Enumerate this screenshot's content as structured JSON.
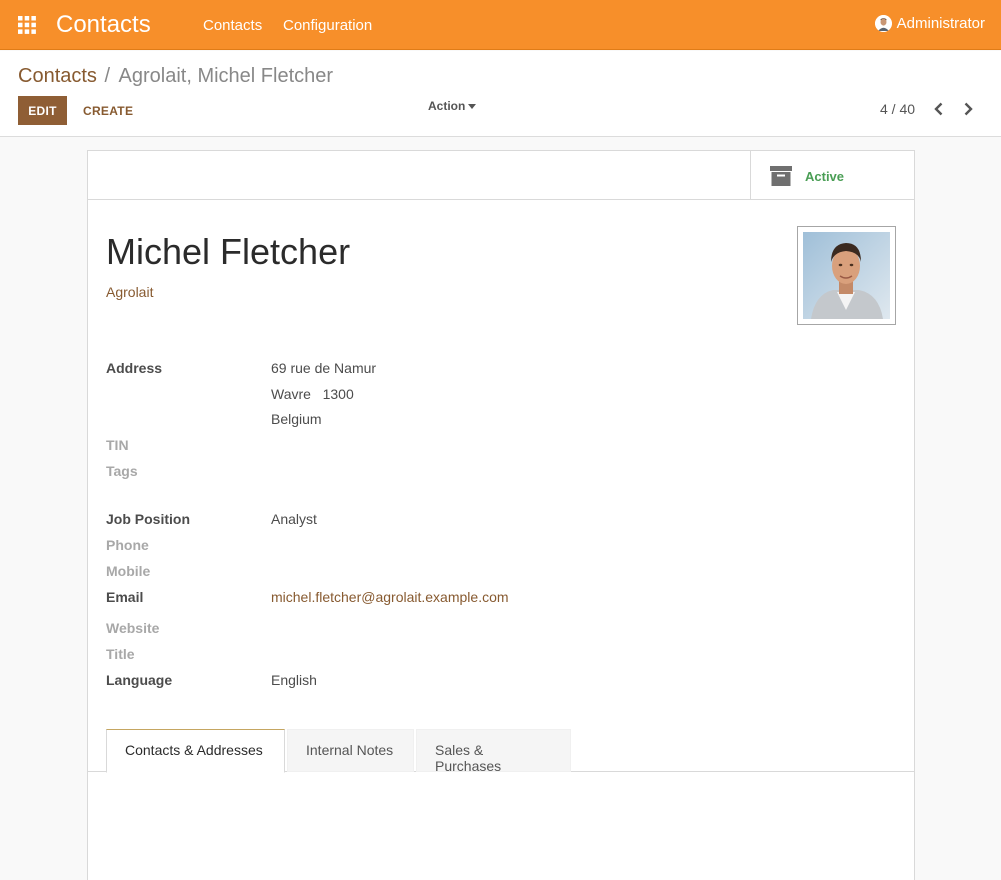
{
  "topbar": {
    "app_title": "Contacts",
    "menu": [
      "Contacts",
      "Configuration"
    ],
    "user_name": "Administrator",
    "colors": {
      "background": "#f78f2a",
      "text": "#ffffff"
    }
  },
  "control_panel": {
    "breadcrumb": {
      "parent": "Contacts",
      "separator": "/",
      "current": "Agrolait, Michel Fletcher"
    },
    "edit_label": "EDIT",
    "create_label": "CREATE",
    "action_label": "Action",
    "pager": "4 / 40"
  },
  "sheet": {
    "status_button": {
      "label": "Active",
      "icon": "archive-icon",
      "color": "#4a9e55"
    },
    "name": "Michel Fletcher",
    "company": "Agrolait",
    "fields": {
      "address_label": "Address",
      "address_street": "69 rue de Namur",
      "address_city_zip": "Wavre   1300",
      "address_country": "Belgium",
      "tin_label": "TIN",
      "tags_label": "Tags",
      "job_label": "Job Position",
      "job_value": "Analyst",
      "phone_label": "Phone",
      "mobile_label": "Mobile",
      "email_label": "Email",
      "email_value": "michel.fletcher@agrolait.example.com",
      "website_label": "Website",
      "title_label": "Title",
      "language_label": "Language",
      "language_value": "English"
    },
    "tabs": [
      {
        "label": "Contacts & Addresses",
        "active": true
      },
      {
        "label": "Internal Notes",
        "active": false
      },
      {
        "label": "Sales & Purchases",
        "active": false
      }
    ]
  },
  "accent_color": "#875a30"
}
